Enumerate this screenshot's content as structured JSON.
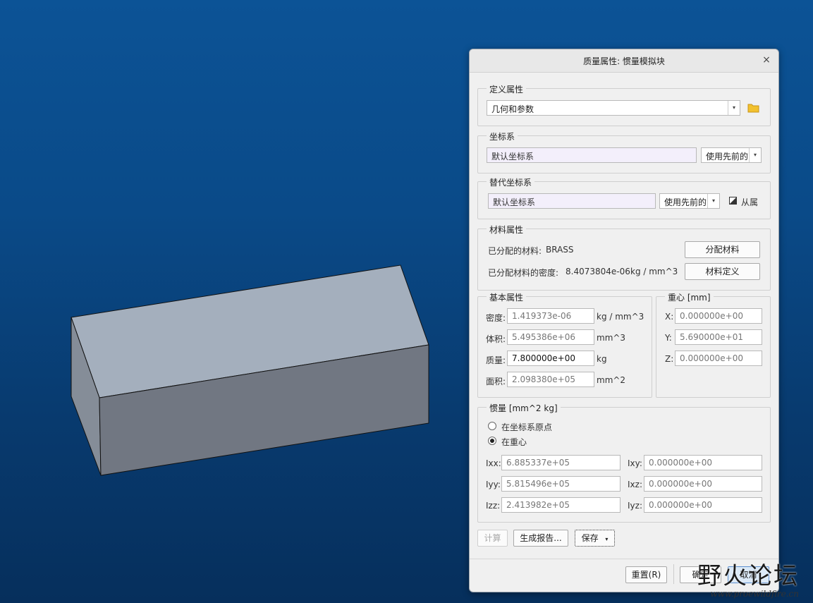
{
  "dialog": {
    "title": "质量属性: 惯量模拟块",
    "close": "×"
  },
  "define": {
    "legend": "定义属性",
    "value": "几何和参数",
    "arrow": "▾"
  },
  "csys": {
    "legend": "坐标系",
    "value": "默认坐标系",
    "combo": "使用先前的",
    "arrow": "▾"
  },
  "alt_csys": {
    "legend": "替代坐标系",
    "value": "默认坐标系",
    "combo": "使用先前的",
    "arrow": "▾",
    "dependent_label": "从属"
  },
  "material": {
    "legend": "材料属性",
    "assigned_label": "已分配的材料:",
    "assigned_value": "BRASS",
    "density_label": "已分配材料的密度:",
    "density_value": "8.4073804e-06",
    "density_unit": "kg / mm^3",
    "assign_button": "分配材料",
    "define_button": "材料定义"
  },
  "basic": {
    "legend": "基本属性",
    "rows": [
      {
        "label": "密度:",
        "value": "1.419373e-06",
        "unit": "kg / mm^3"
      },
      {
        "label": "体积:",
        "value": "5.495386e+06",
        "unit": "mm^3"
      },
      {
        "label": "质量:",
        "value": "7.800000e+00",
        "unit": "kg"
      },
      {
        "label": "面积:",
        "value": "2.098380e+05",
        "unit": "mm^2"
      }
    ]
  },
  "cog": {
    "legend": "重心 [mm]",
    "rows": [
      {
        "label": "X:",
        "value": "0.000000e+00"
      },
      {
        "label": "Y:",
        "value": "5.690000e+01"
      },
      {
        "label": "Z:",
        "value": "0.000000e+00"
      }
    ]
  },
  "inertia": {
    "legend": "惯量 [mm^2 kg]",
    "radio_origin": "在坐标系原点",
    "radio_cog": "在重心",
    "selected": "cog",
    "left": [
      {
        "label": "Ixx:",
        "value": "6.885337e+05"
      },
      {
        "label": "Iyy:",
        "value": "5.815496e+05"
      },
      {
        "label": "Izz:",
        "value": "2.413982e+05"
      }
    ],
    "right": [
      {
        "label": "Ixy:",
        "value": "0.000000e+00"
      },
      {
        "label": "Ixz:",
        "value": "0.000000e+00"
      },
      {
        "label": "Iyz:",
        "value": "0.000000e+00"
      }
    ]
  },
  "actions": {
    "compute": "计算",
    "report": "生成报告...",
    "save": "保存",
    "save_arrow": "▾"
  },
  "footer": {
    "reset": "重置(R)",
    "ok": "确定",
    "cancel": "取消"
  },
  "watermark": {
    "text": "野火论坛",
    "url": "www.proewildfire.cn"
  },
  "colors": {
    "block_top": "#a4afbd",
    "block_front": "#717782",
    "block_side": "#858d98",
    "folder": "#f2c12e"
  }
}
